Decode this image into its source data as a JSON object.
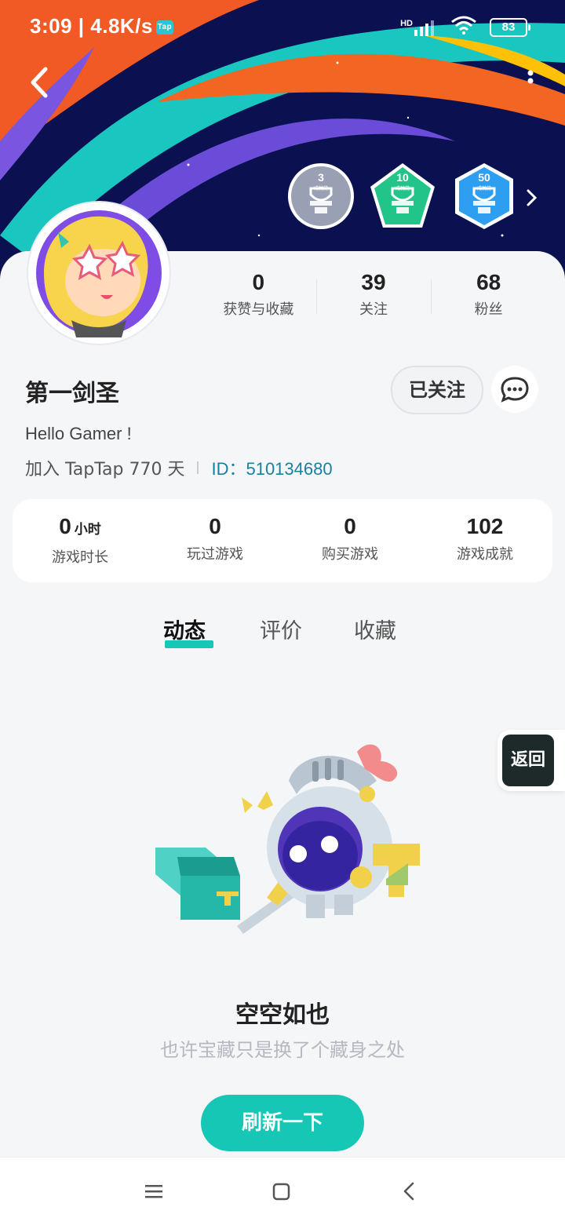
{
  "status_bar": {
    "time_speed": "3:09 | 4.8K/s",
    "tap_badge": "Tap",
    "network": "HD",
    "battery": "83"
  },
  "header": {
    "back_icon": "chevron-left-icon",
    "more_icon": "vertical-dots-icon",
    "achievement_badges": [
      {
        "count": "3",
        "label": "成就党",
        "color": "#9aa0b4"
      },
      {
        "count": "10",
        "label": "成就党",
        "color": "#22c48a"
      },
      {
        "count": "50",
        "label": "成就党",
        "color": "#2e9ef0"
      }
    ]
  },
  "profile": {
    "stats": [
      {
        "value": "0",
        "label": "获赞与收藏"
      },
      {
        "value": "39",
        "label": "关注"
      },
      {
        "value": "68",
        "label": "粉丝"
      }
    ],
    "username": "第一剑圣",
    "follow_label": "已关注",
    "chat_icon": "chat-bubble-icon",
    "bio": "Hello Gamer !",
    "join_text": "加入 TapTap 770 天",
    "id_text": "ID：510134680"
  },
  "game_stats": [
    {
      "value": "0",
      "unit": "小时",
      "label": "游戏时长"
    },
    {
      "value": "0",
      "unit": "",
      "label": "玩过游戏"
    },
    {
      "value": "0",
      "unit": "",
      "label": "购买游戏"
    },
    {
      "value": "102",
      "unit": "",
      "label": "游戏成就"
    }
  ],
  "tabs": [
    {
      "label": "动态",
      "active": true
    },
    {
      "label": "评价",
      "active": false
    },
    {
      "label": "收藏",
      "active": false
    }
  ],
  "float_back": "返回",
  "empty_state": {
    "title": "空空如也",
    "subtitle": "也许宝藏只是换了个藏身之处",
    "button": "刷新一下"
  },
  "colors": {
    "accent": "#17c7b6",
    "id_link": "#1b7fa0",
    "banner_bg": "#0b1150"
  }
}
